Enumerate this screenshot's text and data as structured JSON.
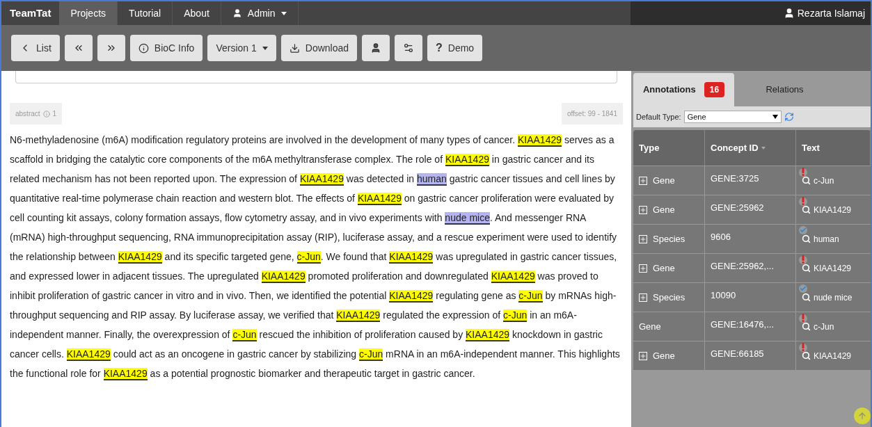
{
  "navbar": {
    "brand": "TeamTat",
    "items": [
      {
        "label": "Projects",
        "selected": true,
        "kind": "link"
      },
      {
        "label": "Tutorial",
        "selected": false,
        "kind": "link"
      },
      {
        "label": "About",
        "selected": false,
        "kind": "link"
      },
      {
        "label": "Admin",
        "selected": false,
        "kind": "dropdown"
      }
    ],
    "user": "Rezarta Islamaj"
  },
  "toolbar": [
    {
      "kind": "back",
      "label": "List"
    },
    {
      "kind": "prev"
    },
    {
      "kind": "next"
    },
    {
      "kind": "info",
      "label": "BioC Info"
    },
    {
      "kind": "dropdown",
      "label": "Version 1"
    },
    {
      "kind": "download",
      "label": "Download"
    },
    {
      "kind": "user"
    },
    {
      "kind": "settings"
    },
    {
      "kind": "help",
      "icon_text": "?",
      "label": "Demo"
    }
  ],
  "passage": {
    "type": "abstract",
    "note_count": "1",
    "offset": "offset: 99 - 1841",
    "segments": [
      {
        "kind": "plain",
        "text": "N6-methyladenosine (m6A) modification regulatory proteins are involved in the development of many types of cancer. "
      },
      {
        "kind": "gene",
        "text": "KIAA1429"
      },
      {
        "kind": "plain",
        "text": " serves as a scaffold in bridging the catalytic core components of the m6A methyltransferase complex. The role of "
      },
      {
        "kind": "gene",
        "text": "KIAA1429"
      },
      {
        "kind": "plain",
        "text": " in gastric cancer and its related mechanism has not been reported upon. The expression of "
      },
      {
        "kind": "gene",
        "text": "KIAA1429"
      },
      {
        "kind": "plain",
        "text": " was detected in "
      },
      {
        "kind": "species",
        "text": "human"
      },
      {
        "kind": "plain",
        "text": " gastric cancer tissues and cell lines by quantitative real-time polymerase chain reaction and western blot. The effects of "
      },
      {
        "kind": "gene",
        "text": "KIAA1429"
      },
      {
        "kind": "plain",
        "text": " on gastric cancer proliferation were evaluated by cell counting kit assays, colony formation assays, flow cytometry assay, and in vivo experiments with "
      },
      {
        "kind": "species",
        "text": "nude mice"
      },
      {
        "kind": "plain",
        "text": ". And messenger RNA (mRNA) high-throughput sequencing, RNA immunoprecipitation assay (RIP), luciferase assay, and a rescue experiment were used to identify the relationship between "
      },
      {
        "kind": "gene",
        "text": "KIAA1429"
      },
      {
        "kind": "plain",
        "text": " and its specific targeted gene, "
      },
      {
        "kind": "gene",
        "text": "c-Jun"
      },
      {
        "kind": "plain",
        "text": ". We found that "
      },
      {
        "kind": "gene",
        "text": "KIAA1429"
      },
      {
        "kind": "plain",
        "text": " was upregulated in gastric cancer tissues, and expressed lower in adjacent tissues. The upregulated "
      },
      {
        "kind": "gene",
        "text": "KIAA1429"
      },
      {
        "kind": "plain",
        "text": " promoted proliferation and downregulated "
      },
      {
        "kind": "gene",
        "text": "KIAA1429"
      },
      {
        "kind": "plain",
        "text": " was proved to inhibit proliferation of gastric cancer in vitro and in vivo. Then, we identified the potential "
      },
      {
        "kind": "gene",
        "text": "KIAA1429"
      },
      {
        "kind": "plain",
        "text": " regulating gene as "
      },
      {
        "kind": "gene",
        "text": "c-Jun"
      },
      {
        "kind": "plain",
        "text": " by mRNAs high-throughput sequencing and RIP assay. By luciferase assay, we verified that "
      },
      {
        "kind": "gene",
        "text": "KIAA1429"
      },
      {
        "kind": "plain",
        "text": " regulated the expression of "
      },
      {
        "kind": "gene",
        "text": "c-Jun"
      },
      {
        "kind": "plain",
        "text": " in an m6A-independent manner. Finally, the overexpression of "
      },
      {
        "kind": "gene",
        "text": "c-Jun"
      },
      {
        "kind": "plain",
        "text": " rescued the inhibition of proliferation caused by "
      },
      {
        "kind": "gene",
        "text": "KIAA1429"
      },
      {
        "kind": "plain",
        "text": " knockdown in gastric cancer cells. "
      },
      {
        "kind": "gene",
        "text": "KIAA1429"
      },
      {
        "kind": "plain",
        "text": " could act as an oncogene in gastric cancer by stabilizing "
      },
      {
        "kind": "gene",
        "text": "c-Jun"
      },
      {
        "kind": "plain",
        "text": " mRNA in an m6A-independent manner. This highlights the functional role for "
      },
      {
        "kind": "gene",
        "text": "KIAA1429"
      },
      {
        "kind": "plain",
        "text": " as a potential prognostic biomarker and therapeutic target in gastric cancer."
      }
    ]
  },
  "panel": {
    "tabs": [
      {
        "label": "Annotations",
        "badge": "16",
        "selected": true
      },
      {
        "label": "Relations",
        "selected": false
      }
    ],
    "default_type_label": "Default Type:",
    "default_type": "Gene",
    "table": {
      "columns": [
        "Type",
        "Concept ID",
        "Text"
      ],
      "rows": [
        {
          "type": "Gene",
          "expandable": true,
          "concept_id": "GENE:3725",
          "text": "c-Jun",
          "verified": false
        },
        {
          "type": "Gene",
          "expandable": true,
          "concept_id": "GENE:25962",
          "text": "KIAA1429",
          "verified": false
        },
        {
          "type": "Species",
          "expandable": true,
          "concept_id": "9606",
          "text": "human",
          "verified": true
        },
        {
          "type": "Gene",
          "expandable": true,
          "concept_id": "GENE:25962,...",
          "text": "KIAA1429",
          "verified": false
        },
        {
          "type": "Species",
          "expandable": true,
          "concept_id": "10090",
          "text": "nude mice",
          "verified": true
        },
        {
          "type": "Gene",
          "expandable": false,
          "concept_id": "GENE:16476,...",
          "text": "c-Jun",
          "verified": false
        },
        {
          "type": "Gene",
          "expandable": true,
          "concept_id": "GENE:66185",
          "text": "KIAA1429",
          "verified": false
        }
      ]
    }
  }
}
